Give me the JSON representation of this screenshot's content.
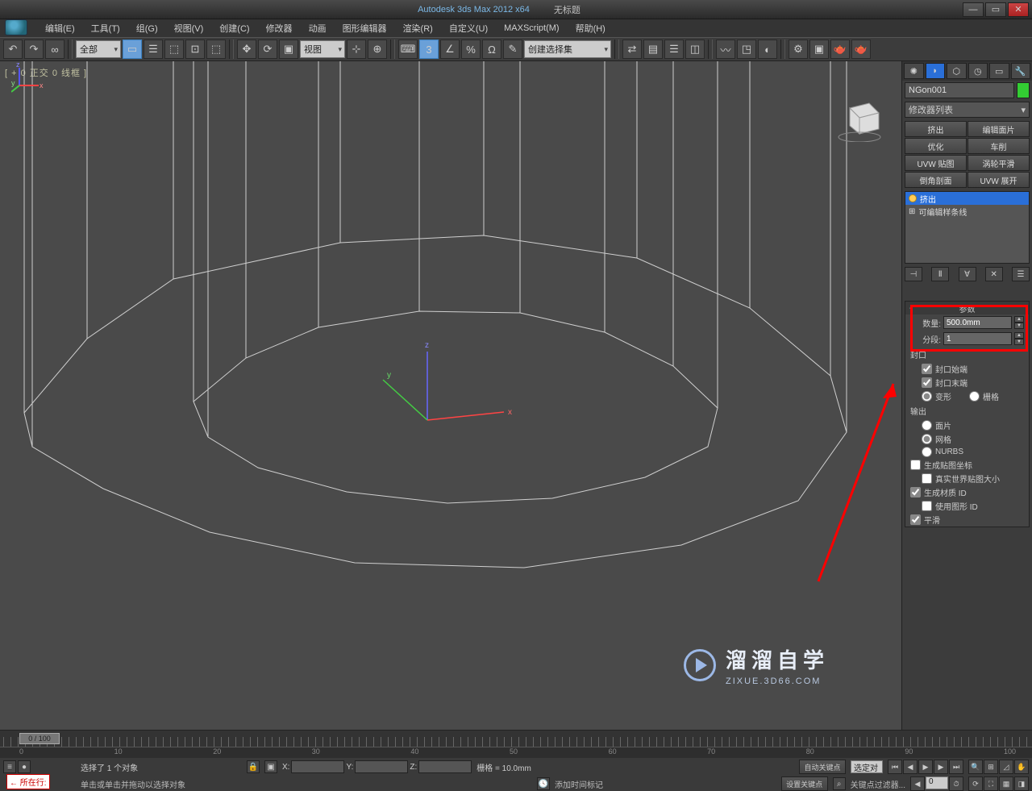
{
  "title": {
    "app": "Autodesk 3ds Max  2012 x64",
    "file": "无标题"
  },
  "menu": {
    "items": [
      "编辑(E)",
      "工具(T)",
      "组(G)",
      "视图(V)",
      "创建(C)",
      "修改器",
      "动画",
      "图形编辑器",
      "渲染(R)",
      "自定义(U)",
      "MAXScript(M)",
      "帮助(H)"
    ]
  },
  "toolbar": {
    "select_filter": "全部",
    "ref_sys": "视图",
    "named_sel": "创建选择集"
  },
  "viewport": {
    "label": "[ + 0 正交  0 线框 ]"
  },
  "panel": {
    "object_name": "NGon001",
    "modlist_label": "修改器列表",
    "buttons": [
      "挤出",
      "编辑面片",
      "优化",
      "车削",
      "UVW 贴图",
      "涡轮平滑",
      "倒角剖面",
      "UVW 展开"
    ],
    "stack": {
      "item1": "挤出",
      "item2": "可编辑样条线"
    },
    "rollout_title": "参数",
    "amount_label": "数量:",
    "amount_value": "500.0mm",
    "segs_label": "分段:",
    "segs_value": "1",
    "cap_group": "封口",
    "cap_start": "封口始端",
    "cap_end": "封口末端",
    "morph": "变形",
    "grid": "栅格",
    "output_group": "输出",
    "patch": "面片",
    "mesh": "网格",
    "nurbs": "NURBS",
    "gen_map": "生成贴图坐标",
    "real_world": "真实世界贴图大小",
    "gen_mat": "生成材质 ID",
    "use_shape": "使用图形 ID",
    "smooth": "平滑"
  },
  "timeline": {
    "frame": "0 / 100",
    "marks": [
      "0",
      "10",
      "20",
      "30",
      "40",
      "50",
      "60",
      "70",
      "80",
      "90",
      "100"
    ]
  },
  "status": {
    "sel": "选择了 1 个对象",
    "prompt": "单击或单击并拖动以选择对象",
    "xl": "X:",
    "yl": "Y:",
    "zl": "Z:",
    "grid": "栅格 = 10.0mm",
    "addtime": "添加时间标记",
    "autokey": "自动关键点",
    "setkey": "设置关键点",
    "selset": "选定对",
    "keyfilter": "关键点过滤器...",
    "nowline_lbl": "所在行:",
    "zero": "0"
  },
  "brand": {
    "t1": "溜溜自学",
    "t2": "ZIXUE.3D66.COM"
  }
}
